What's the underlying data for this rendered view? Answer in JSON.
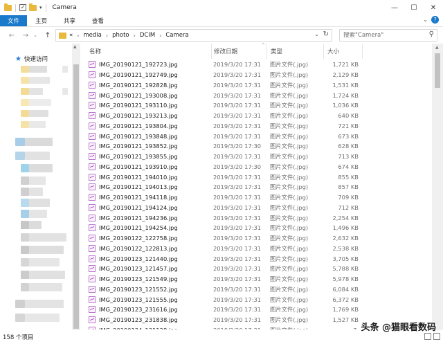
{
  "window": {
    "title": "Camera"
  },
  "ribbon": {
    "tabs": [
      "文件",
      "主页",
      "共享",
      "查看"
    ]
  },
  "address": {
    "crumbs": [
      "«",
      "media",
      "photo",
      "DCIM",
      "Camera"
    ]
  },
  "search": {
    "placeholder": "搜索\"Camera\""
  },
  "sidebar": {
    "quick_access": "快速访问"
  },
  "columns": {
    "name": "名称",
    "date": "修改日期",
    "type": "类型",
    "size": "大小"
  },
  "files": [
    {
      "name": "IMG_20190121_192723.jpg",
      "date": "2019/3/20 17:31",
      "type": "图片文件(.jpg)",
      "size": "1,721 KB"
    },
    {
      "name": "IMG_20190121_192749.jpg",
      "date": "2019/3/20 17:31",
      "type": "图片文件(.jpg)",
      "size": "2,129 KB"
    },
    {
      "name": "IMG_20190121_192828.jpg",
      "date": "2019/3/20 17:31",
      "type": "图片文件(.jpg)",
      "size": "1,531 KB"
    },
    {
      "name": "IMG_20190121_193008.jpg",
      "date": "2019/3/20 17:31",
      "type": "图片文件(.jpg)",
      "size": "1,724 KB"
    },
    {
      "name": "IMG_20190121_193110.jpg",
      "date": "2019/3/20 17:31",
      "type": "图片文件(.jpg)",
      "size": "1,036 KB"
    },
    {
      "name": "IMG_20190121_193213.jpg",
      "date": "2019/3/20 17:31",
      "type": "图片文件(.jpg)",
      "size": "640 KB"
    },
    {
      "name": "IMG_20190121_193804.jpg",
      "date": "2019/3/20 17:31",
      "type": "图片文件(.jpg)",
      "size": "721 KB"
    },
    {
      "name": "IMG_20190121_193848.jpg",
      "date": "2019/3/20 17:31",
      "type": "图片文件(.jpg)",
      "size": "673 KB"
    },
    {
      "name": "IMG_20190121_193852.jpg",
      "date": "2019/3/20 17:30",
      "type": "图片文件(.jpg)",
      "size": "628 KB"
    },
    {
      "name": "IMG_20190121_193855.jpg",
      "date": "2019/3/20 17:31",
      "type": "图片文件(.jpg)",
      "size": "713 KB"
    },
    {
      "name": "IMG_20190121_193910.jpg",
      "date": "2019/3/20 17:30",
      "type": "图片文件(.jpg)",
      "size": "674 KB"
    },
    {
      "name": "IMG_20190121_194010.jpg",
      "date": "2019/3/20 17:31",
      "type": "图片文件(.jpg)",
      "size": "855 KB"
    },
    {
      "name": "IMG_20190121_194013.jpg",
      "date": "2019/3/20 17:31",
      "type": "图片文件(.jpg)",
      "size": "857 KB"
    },
    {
      "name": "IMG_20190121_194118.jpg",
      "date": "2019/3/20 17:31",
      "type": "图片文件(.jpg)",
      "size": "709 KB"
    },
    {
      "name": "IMG_20190121_194124.jpg",
      "date": "2019/3/20 17:31",
      "type": "图片文件(.jpg)",
      "size": "712 KB"
    },
    {
      "name": "IMG_20190121_194236.jpg",
      "date": "2019/3/20 17:31",
      "type": "图片文件(.jpg)",
      "size": "2,254 KB"
    },
    {
      "name": "IMG_20190121_194254.jpg",
      "date": "2019/3/20 17:31",
      "type": "图片文件(.jpg)",
      "size": "1,496 KB"
    },
    {
      "name": "IMG_20190122_122758.jpg",
      "date": "2019/3/20 17:31",
      "type": "图片文件(.jpg)",
      "size": "2,632 KB"
    },
    {
      "name": "IMG_20190122_122813.jpg",
      "date": "2019/3/20 17:31",
      "type": "图片文件(.jpg)",
      "size": "2,538 KB"
    },
    {
      "name": "IMG_20190123_121440.jpg",
      "date": "2019/3/20 17:31",
      "type": "图片文件(.jpg)",
      "size": "3,705 KB"
    },
    {
      "name": "IMG_20190123_121457.jpg",
      "date": "2019/3/20 17:31",
      "type": "图片文件(.jpg)",
      "size": "5,788 KB"
    },
    {
      "name": "IMG_20190123_121549.jpg",
      "date": "2019/3/20 17:31",
      "type": "图片文件(.jpg)",
      "size": "5,978 KB"
    },
    {
      "name": "IMG_20190123_121552.jpg",
      "date": "2019/3/20 17:31",
      "type": "图片文件(.jpg)",
      "size": "6,084 KB"
    },
    {
      "name": "IMG_20190123_121555.jpg",
      "date": "2019/3/20 17:31",
      "type": "图片文件(.jpg)",
      "size": "6,372 KB"
    },
    {
      "name": "IMG_20190123_231616.jpg",
      "date": "2019/3/20 17:31",
      "type": "图片文件(.jpg)",
      "size": "1,769 KB"
    },
    {
      "name": "IMG_20190123_231838.jpg",
      "date": "2019/3/20 17:31",
      "type": "图片文件(.jpg)",
      "size": "1,527 KB"
    },
    {
      "name": "IMG_20190124_121128.jpg",
      "date": "2019/3/20 17:31",
      "type": "图片文件(.jpg)",
      "size": "7,"
    }
  ],
  "status": {
    "item_count": "158 个项目"
  },
  "watermark": {
    "text": "头条 @猫眼看数码"
  },
  "colors": {
    "accent": "#1979ca",
    "folder": "#e8b93c",
    "image_icon": "#b879c9"
  }
}
